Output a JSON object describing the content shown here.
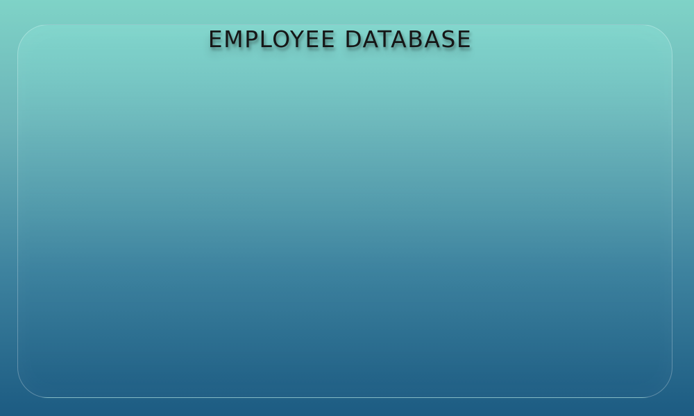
{
  "header": {
    "title": "EMPLOYEE DATABASE"
  },
  "colors": {
    "background_top": "#7fd3c7",
    "background_bottom": "#1c5b82",
    "title_text": "#161616"
  }
}
